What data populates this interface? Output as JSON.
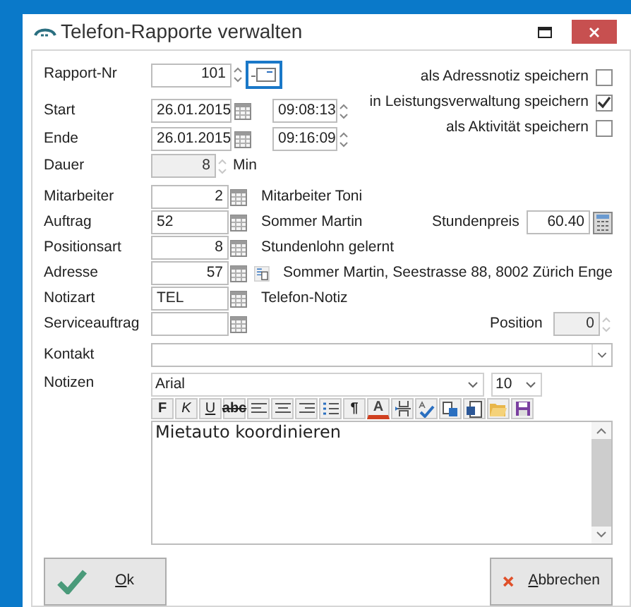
{
  "window": {
    "title": "Telefon-Rapporte verwalten"
  },
  "rapport_nr": {
    "label": "Rapport-Nr",
    "value": "101"
  },
  "start": {
    "label": "Start",
    "date": "26.01.2015",
    "time": "09:08:13"
  },
  "ende": {
    "label": "Ende",
    "date": "26.01.2015",
    "time": "09:16:09"
  },
  "dauer": {
    "label": "Dauer",
    "value": "8",
    "unit": "Min",
    "disabled": true
  },
  "options": [
    {
      "label": "als Adressnotiz speichern",
      "checked": false
    },
    {
      "label": "in Leistungsverwaltung speichern",
      "checked": true
    },
    {
      "label": "als Aktivität speichern",
      "checked": false
    }
  ],
  "lookups": [
    {
      "label": "Mitarbeiter",
      "value": "2",
      "kind": "number",
      "description": "Mitarbeiter Toni"
    },
    {
      "label": "Auftrag",
      "value": "52",
      "kind": "code",
      "description": "Sommer Martin"
    },
    {
      "label": "Positionsart",
      "value": "8",
      "kind": "number",
      "description": "Stundenlohn gelernt"
    },
    {
      "label": "Adresse",
      "value": "57",
      "kind": "number",
      "description": "Sommer Martin, Seestrasse 88, 8002 Zürich Enge"
    },
    {
      "label": "Notizart",
      "value": "TEL",
      "kind": "code",
      "description": "Telefon-Notiz"
    },
    {
      "label": "Serviceauftrag"
    }
  ],
  "stundenpreis": {
    "label": "Stundenpreis",
    "value": "60.40"
  },
  "position": {
    "label": "Position",
    "value": "0",
    "disabled": true
  },
  "kontakt": {
    "label": "Kontakt"
  },
  "notizen": {
    "label": "Notizen",
    "font": "Arial",
    "size": "10",
    "text": "Mietauto koordinieren",
    "toolbar": [
      {
        "kind": "bold",
        "label": "F"
      },
      {
        "kind": "italic",
        "label": "K"
      },
      {
        "kind": "underline",
        "label": "U"
      },
      {
        "kind": "strike",
        "label": "abc"
      },
      {
        "kind": "align-left"
      },
      {
        "kind": "align-center"
      },
      {
        "kind": "align-right"
      },
      {
        "kind": "bullets"
      },
      {
        "kind": "paragraph",
        "label": "¶"
      },
      {
        "kind": "font-color",
        "label": "A"
      },
      {
        "kind": "page-break"
      },
      {
        "kind": "spellcheck"
      },
      {
        "kind": "replace"
      },
      {
        "kind": "word"
      },
      {
        "kind": "open"
      },
      {
        "kind": "save"
      }
    ]
  },
  "buttons": [
    {
      "kind": "ok",
      "label": "Ok"
    },
    {
      "kind": "cancel",
      "label": "Abbrechen"
    }
  ]
}
